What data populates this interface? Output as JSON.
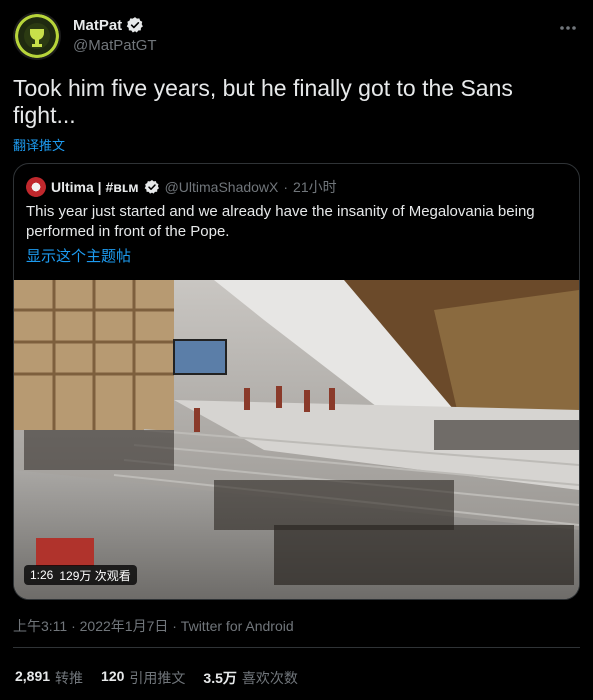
{
  "author": {
    "display_name": "MatPat",
    "handle": "@MatPatGT",
    "verified": true
  },
  "tweet": {
    "text": "Took him five years, but he finally got to the Sans fight...",
    "translate_label": "翻译推文"
  },
  "quoted": {
    "display_name": "Ultima | #ʙʟᴍ",
    "handle": "@UltimaShadowX",
    "separator": "·",
    "time": "21小时",
    "text": "This year just started and we already have the insanity of Megalovania being performed in front of the Pope.",
    "thread_label": "显示这个主题帖",
    "video": {
      "duration": "1:26",
      "views": "129万 次观看"
    }
  },
  "meta": {
    "timestamp": "上午3:11 · 2022年1月7日 · Twitter for Android"
  },
  "stats": {
    "retweets": "2,891",
    "retweets_label": "转推",
    "quotes": "120",
    "quotes_label": "引用推文",
    "likes": "3.5万",
    "likes_label": "喜欢次数"
  },
  "colors": {
    "background": "#000000",
    "text": "#e7e9ea",
    "muted": "#71767b",
    "link": "#1d9bf0",
    "border": "#2f3336"
  }
}
